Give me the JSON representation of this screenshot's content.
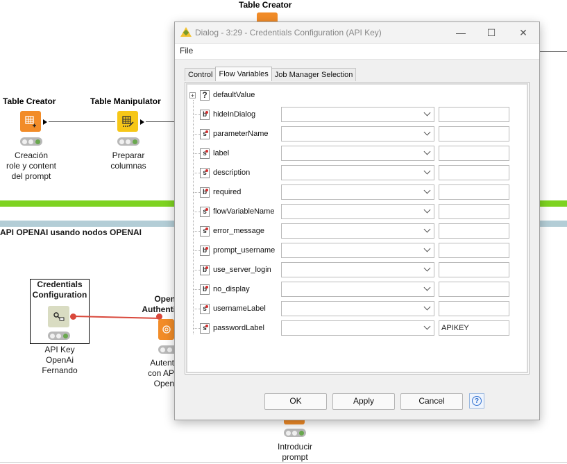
{
  "canvas": {
    "top_node_title": "Table Creator",
    "table_creator": {
      "title": "Table Creator",
      "label_lines": [
        "Creación",
        "role y content",
        "del prompt"
      ]
    },
    "table_manipulator": {
      "title": "Table Manipulator",
      "label_lines": [
        "Preparar",
        "columnas"
      ]
    },
    "section_title": "API OPENAI usando nodos OPENAI",
    "credentials_node": {
      "title_lines": [
        "Credentials",
        "Configuration"
      ],
      "label_lines": [
        "API Key",
        "OpenAi",
        "Fernando"
      ]
    },
    "openai_node": {
      "title_lines": [
        "Open",
        "Authenti"
      ],
      "label_lines": [
        "Autent",
        "con AP",
        "Open"
      ]
    },
    "introducir_node": {
      "label_lines": [
        "Introducir",
        "prompt"
      ]
    },
    "colors": {
      "green_band": "#7ed321",
      "blue_band": "#b3cdd6",
      "orange_node": "#f28c28",
      "yellow_node": "#f6c718",
      "connection_red": "#d9483b"
    }
  },
  "dialog": {
    "title": "Dialog - 3:29 - Credentials Configuration (API Key)",
    "window_controls": {
      "minimize": "—",
      "maximize": "☐",
      "close": "✕"
    },
    "menu": {
      "file": "File"
    },
    "tabs": [
      {
        "label": "Control",
        "active": false
      },
      {
        "label": "Flow Variables",
        "active": true
      },
      {
        "label": "Job Manager Selection",
        "active": false
      }
    ],
    "variables": [
      {
        "name": "defaultValue",
        "type": "?",
        "expandable": true,
        "combo": null,
        "field": null
      },
      {
        "name": "hideInDialog",
        "type": "b",
        "combo": "",
        "field": ""
      },
      {
        "name": "parameterName",
        "type": "s",
        "combo": "",
        "field": ""
      },
      {
        "name": "label",
        "type": "s",
        "combo": "",
        "field": ""
      },
      {
        "name": "description",
        "type": "s",
        "combo": "",
        "field": ""
      },
      {
        "name": "required",
        "type": "b",
        "combo": "",
        "field": ""
      },
      {
        "name": "flowVariableName",
        "type": "s",
        "combo": "",
        "field": ""
      },
      {
        "name": "error_message",
        "type": "s",
        "combo": "",
        "field": ""
      },
      {
        "name": "prompt_username",
        "type": "b",
        "combo": "",
        "field": ""
      },
      {
        "name": "use_server_login",
        "type": "b",
        "combo": "",
        "field": ""
      },
      {
        "name": "no_display",
        "type": "b",
        "combo": "",
        "field": ""
      },
      {
        "name": "usernameLabel",
        "type": "s",
        "combo": "",
        "field": ""
      },
      {
        "name": "passwordLabel",
        "type": "s",
        "combo": "",
        "field": "APIKEY"
      }
    ],
    "buttons": {
      "ok": "OK",
      "apply": "Apply",
      "cancel": "Cancel",
      "help": "?"
    }
  }
}
